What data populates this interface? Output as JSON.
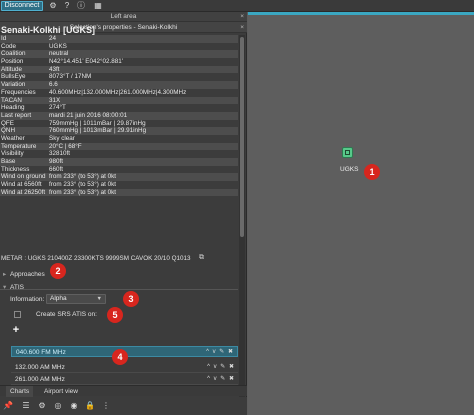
{
  "toolbar": {
    "disconnect_label": "Disconnect",
    "icons": [
      "gear-icon",
      "help-icon",
      "info-icon",
      "panel-icon"
    ]
  },
  "left_area": {
    "title": "Left area",
    "close": "×"
  },
  "selection": {
    "title": "Selection's properties - Senaki-Kolkhi",
    "close": "×"
  },
  "airport": {
    "name": "Senaki-Kolkhi [UGKS]",
    "properties": [
      {
        "key": "Id",
        "value": "24"
      },
      {
        "key": "Code",
        "value": "UGKS"
      },
      {
        "key": "Coalition",
        "value": "neutral"
      },
      {
        "key": "Position",
        "value": "N42°14.451' E042°02.881'"
      },
      {
        "key": "Altitude",
        "value": "43ft"
      },
      {
        "key": "BullsEye",
        "value": "8073°T / 17NM"
      },
      {
        "key": "Variation",
        "value": "6.6"
      },
      {
        "key": "Frequencies",
        "value": "40.600MHz|132.000MHz|261.000MHz|4.300MHz"
      },
      {
        "key": "TACAN",
        "value": "31X"
      },
      {
        "key": "Heading",
        "value": "274°T"
      },
      {
        "key": "Last report",
        "value": "mardi 21 juin 2016 08:00:01"
      },
      {
        "key": "QFE",
        "value": "759mmHg | 1011mBar | 29.87inHg"
      },
      {
        "key": "QNH",
        "value": "760mmHg | 1013mBar | 29.91inHg"
      },
      {
        "key": "Weather",
        "value": "Sky clear"
      },
      {
        "key": "Temperature",
        "value": "20°C | 68°F"
      },
      {
        "key": "Visibility",
        "value": "32810ft"
      },
      {
        "key": "Base",
        "value": "980ft"
      },
      {
        "key": "Thickness",
        "value": "660ft"
      },
      {
        "key": "Wind on ground",
        "value": "from 233° (to 53°) at 0kt"
      },
      {
        "key": "Wind at 6560ft",
        "value": "from 233° (to 53°) at 0kt"
      },
      {
        "key": "Wind at 26250ft",
        "value": "from 233° (to 53°) at 0kt"
      }
    ],
    "metar": "METAR : UGKS 210400Z 23300KTS 9999SM CAVOK 20/10 Q1013",
    "map_label": "UGKS"
  },
  "tree": {
    "approaches": "Approaches",
    "atis": "ATIS"
  },
  "atis": {
    "information_label": "Information:",
    "information_value": "Alpha",
    "srs_label": "Create SRS ATIS on:",
    "add_label": "+",
    "frequencies": [
      {
        "label": "040.600 FM MHz",
        "selected": true
      },
      {
        "label": "132.000 AM MHz",
        "selected": false
      },
      {
        "label": "261.000 AM MHz",
        "selected": false
      }
    ],
    "row_controls": "^ v ✎ ✖"
  },
  "bottom_tabs": [
    {
      "label": "Charts",
      "active": true
    },
    {
      "label": "Airport view",
      "active": false
    }
  ],
  "bottom_icons": [
    "pin-icon",
    "list-icon",
    "settings-icon",
    "target-icon",
    "radio-icon",
    "lock-icon",
    "more-icon"
  ],
  "callouts": [
    "1",
    "2",
    "3",
    "4",
    "5"
  ],
  "colors": {
    "accent": "#2f6677",
    "callout": "#d7261e",
    "marker": "#57c98a",
    "map_bg": "#5e5e5e"
  }
}
